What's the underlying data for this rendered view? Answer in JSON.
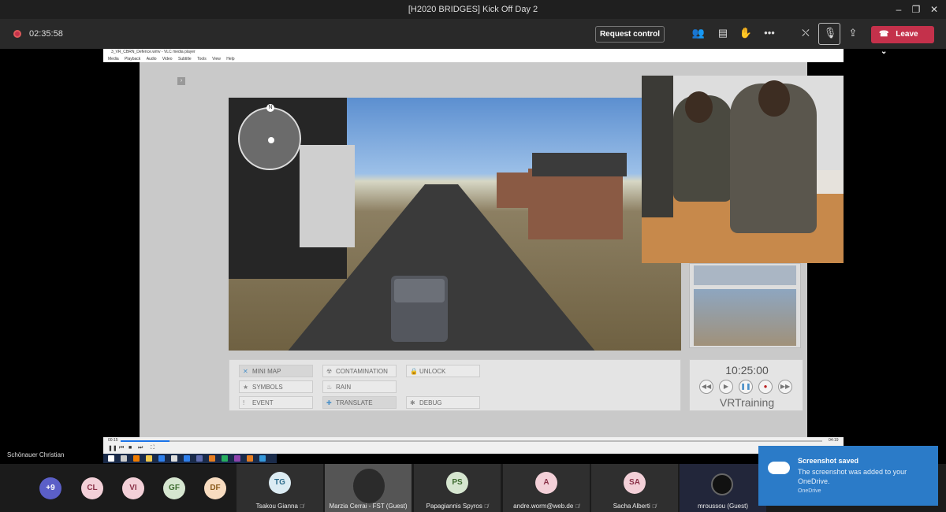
{
  "window": {
    "title": "[H2020 BRIDGES] Kick Off Day 2"
  },
  "meeting": {
    "timer": "02:35:58",
    "request_control": "Request control",
    "leave": "Leave",
    "icons": [
      "participants-icon",
      "chat-icon",
      "raise-hand-icon",
      "more-icon",
      "camera-off-icon",
      "mic-off-icon",
      "share-icon"
    ]
  },
  "vlc": {
    "title": "3_VR_CBRN_Defence.wmv - VLC media player",
    "menu": [
      "Media",
      "Playback",
      "Audio",
      "Video",
      "Subtitle",
      "Tools",
      "View",
      "Help"
    ],
    "time_elapsed": "00:15",
    "time_total": "04:19",
    "progress_fraction": 0.07
  },
  "vr_ui": {
    "buttons_col1": [
      "MINI MAP",
      "SYMBOLS",
      "EVENT"
    ],
    "buttons_col2": [
      "CONTAMINATION",
      "RAIN",
      "TRANSLATE"
    ],
    "buttons_col3": [
      "UNLOCK",
      "DEBUG"
    ],
    "time": "10:25:00",
    "brand": "VRTraining",
    "minimap_north": "N"
  },
  "presenter": "Schönauer Christian",
  "participants": {
    "overflow": "+9",
    "avatars": [
      {
        "initials": "CL",
        "color": "#f3d0d8"
      },
      {
        "initials": "VI",
        "color": "#f3d0d8"
      },
      {
        "initials": "GF",
        "color": "#d6e6d0"
      },
      {
        "initials": "DF",
        "color": "#f8dcc0"
      }
    ],
    "tiles": [
      {
        "name": "Tsakou Gianna",
        "initials": "TG",
        "color": "#dcecf3"
      },
      {
        "name": "Marzia Cerrai - FST (Guest)",
        "initials": "",
        "color": "#555"
      },
      {
        "name": "Papagiannis Spyros",
        "initials": "PS",
        "color": "#d6e6d0"
      },
      {
        "name": "andre.worm@web.de",
        "initials": "A",
        "color": "#f3d0d8"
      },
      {
        "name": "Sacha Alberti",
        "initials": "SA",
        "color": "#f3d0d8"
      },
      {
        "name": "mroussou (Guest)",
        "initials": "",
        "color": "#22263a"
      }
    ]
  },
  "toast": {
    "title": "Screenshot saved",
    "body": "The screenshot was added to your OneDrive.",
    "source": "OneDrive"
  }
}
